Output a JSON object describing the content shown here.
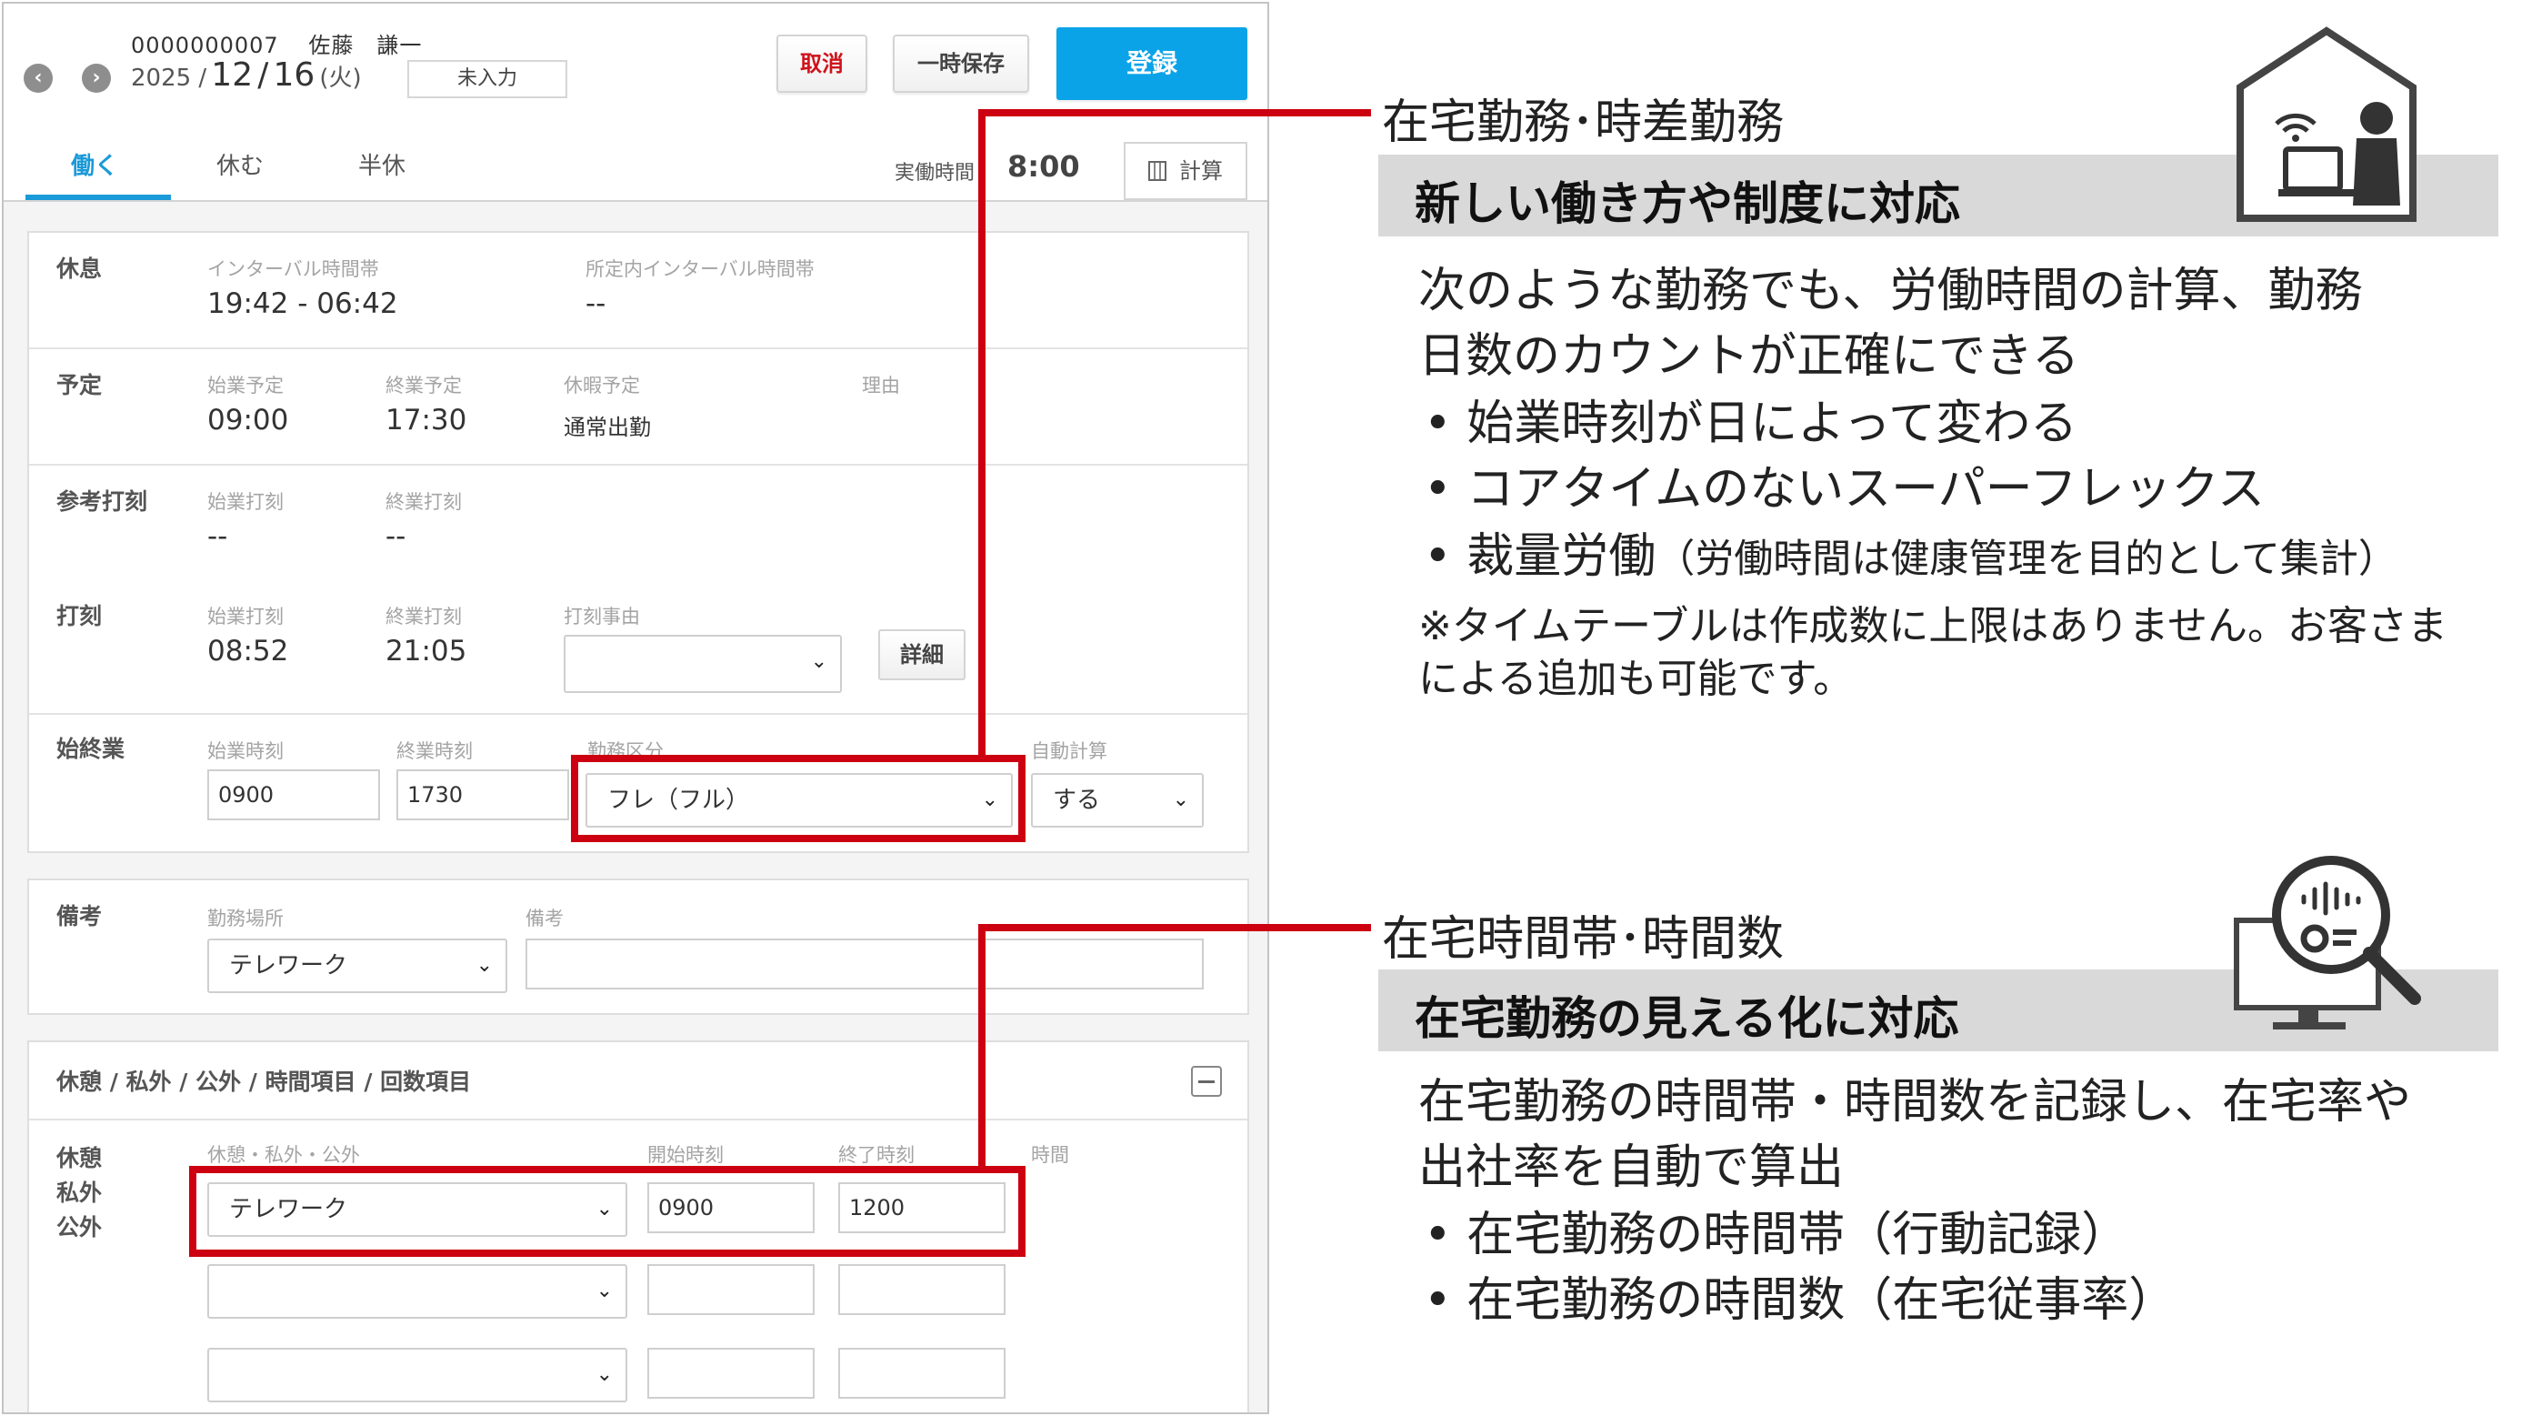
{
  "app": {
    "employee_id": "0000000007",
    "employee_name": "佐藤　謙一",
    "date_year": "2025 /",
    "date_month": "12",
    "date_slash": "/",
    "date_day": "16",
    "date_weekday": "(火)",
    "status": "未入力",
    "buttons": {
      "cancel": "取消",
      "save_draft": "一時保存",
      "register": "登録",
      "calc": "計算",
      "detail": "詳細"
    },
    "tabs": [
      "働く",
      "休む",
      "半休"
    ],
    "actual_hours_label": "実働時間",
    "actual_hours_value": "8:00",
    "rest": {
      "label": "休息",
      "interval_label": "インターバル時間帯",
      "interval_value": "19:42 - 06:42",
      "internal_interval_label": "所定内インターバル時間帯",
      "internal_interval_value": "--"
    },
    "schedule": {
      "label": "予定",
      "start_label": "始業予定",
      "start_value": "09:00",
      "end_label": "終業予定",
      "end_value": "17:30",
      "leave_label": "休暇予定",
      "leave_value": "通常出勤",
      "reason_label": "理由"
    },
    "ref_stamp": {
      "label": "参考打刻",
      "start_label": "始業打刻",
      "start_value": "--",
      "end_label": "終業打刻",
      "end_value": "--"
    },
    "stamp": {
      "label": "打刻",
      "start_label": "始業打刻",
      "start_value": "08:52",
      "end_label": "終業打刻",
      "end_value": "21:05",
      "reason_label": "打刻事由"
    },
    "work_period": {
      "label": "始終業",
      "start_label": "始業時刻",
      "start_value": "0900",
      "end_label": "終業時刻",
      "end_value": "1730",
      "type_label": "勤務区分",
      "type_value": "フレ（フル）",
      "auto_label": "自動計算",
      "auto_value": "する"
    },
    "remarks": {
      "label": "備考",
      "place_label": "勤務場所",
      "place_value": "テレワーク",
      "note_label": "備考"
    },
    "breaks": {
      "section_title": "休憩 / 私外 / 公外 / 時間項目 / 回数項目",
      "row_labels": [
        "休憩",
        "私外",
        "公外"
      ],
      "type_label": "休憩・私外・公外",
      "start_label": "開始時刻",
      "end_label": "終了時刻",
      "time_label": "時間",
      "rows": [
        {
          "type": "テレワーク",
          "start": "0900",
          "end": "1200"
        },
        {
          "type": "",
          "start": "",
          "end": ""
        },
        {
          "type": "",
          "start": "",
          "end": ""
        }
      ]
    }
  },
  "callout1": {
    "title": "在宅勤務･時差勤務",
    "heading": "新しい働き方や制度に対応",
    "body_lines": [
      "次のような勤務でも、労働時間の計算、勤務",
      "日数のカウントが正確にできる"
    ],
    "bullets": [
      "•  始業時刻が日によって変わる",
      "•  コアタイムのないスーパーフレックス"
    ],
    "bullet3_main": "•  裁量労働",
    "bullet3_paren": "（労働時間は健康管理を目的として集計）",
    "notes": [
      "※タイムテーブルは作成数に上限はありません。お客さま",
      "による追加も可能です。"
    ],
    "icon": "home-office-icon"
  },
  "callout2": {
    "title": "在宅時間帯･時間数",
    "heading": "在宅勤務の見える化に対応",
    "body_lines": [
      "在宅勤務の時間帯・時間数を記録し、在宅率や",
      "出社率を自動で算出"
    ],
    "bullets": [
      "•  在宅勤務の時間帯（行動記録）",
      "•  在宅勤務の時間数（在宅従事率）"
    ],
    "icon": "monitor-analytics-icon"
  },
  "colors": {
    "accent_red": "#cc0010",
    "primary_blue": "#0ba3e8",
    "heading_bar": "#d9d9d9"
  }
}
